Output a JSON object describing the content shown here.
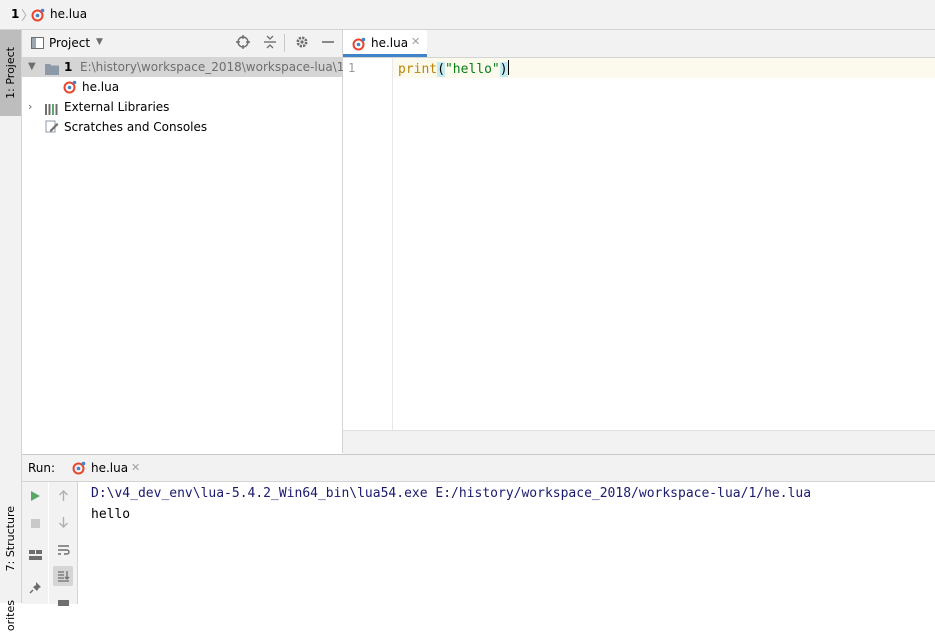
{
  "breadcrumb": {
    "root": "1",
    "file": "he.lua"
  },
  "left_stripe": {
    "project_tab": "1: Project",
    "structure_tab": "7: Structure",
    "favorites_tab": "orites"
  },
  "project_panel": {
    "title": "Project",
    "tree": {
      "root_name": "1",
      "root_path": "E:\\history\\workspace_2018\\workspace-lua\\1",
      "file": "he.lua",
      "external_libraries": "External Libraries",
      "scratches": "Scratches and Consoles"
    }
  },
  "editor": {
    "tab_label": "he.lua",
    "line_number": "1",
    "code": {
      "func": "print",
      "open": "(",
      "string": "\"hello\"",
      "close": ")"
    }
  },
  "run_panel": {
    "label": "Run:",
    "tab_label": "he.lua",
    "console_lines": [
      "D:\\v4_dev_env\\lua-5.4.2_Win64_bin\\lua54.exe E:/history/workspace_2018/workspace-lua/1/he.lua",
      "hello"
    ]
  },
  "colors": {
    "accent": "#4083c9",
    "lua_icon": "#e8452c",
    "string_green": "#067d17",
    "func_orange": "#b8860b"
  }
}
